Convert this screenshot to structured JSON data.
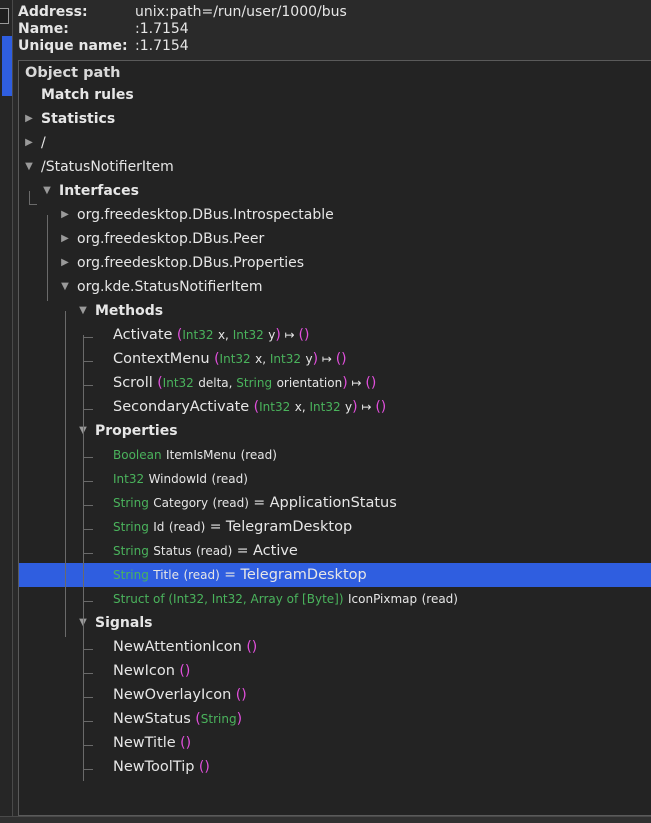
{
  "header": {
    "address_label": "Address:",
    "address_value": "unix:path=/run/user/1000/bus",
    "name_label": "Name:",
    "name_value": ":1.7154",
    "unique_label": "Unique name:",
    "unique_value": ":1.7154"
  },
  "tree": {
    "column_header": "Object path",
    "match_rules": "Match rules",
    "statistics": "Statistics",
    "root": "/",
    "status_notifier_path": "/StatusNotifierItem",
    "interfaces": "Interfaces",
    "iface_introspectable": "org.freedesktop.DBus.Introspectable",
    "iface_peer": "org.freedesktop.DBus.Peer",
    "iface_properties": "org.freedesktop.DBus.Properties",
    "iface_sni": "org.kde.StatusNotifierItem",
    "methods": "Methods",
    "properties": "Properties",
    "signals": "Signals"
  },
  "methods": [
    {
      "name": "Activate",
      "args": [
        {
          "type": "Int32",
          "name": "x"
        },
        {
          "type": "Int32",
          "name": "y"
        }
      ]
    },
    {
      "name": "ContextMenu",
      "args": [
        {
          "type": "Int32",
          "name": "x"
        },
        {
          "type": "Int32",
          "name": "y"
        }
      ]
    },
    {
      "name": "Scroll",
      "args": [
        {
          "type": "Int32",
          "name": "delta"
        },
        {
          "type": "String",
          "name": "orientation"
        }
      ]
    },
    {
      "name": "SecondaryActivate",
      "args": [
        {
          "type": "Int32",
          "name": "x"
        },
        {
          "type": "Int32",
          "name": "y"
        }
      ]
    }
  ],
  "method_punct": {
    "open": "(",
    "sep": ", ",
    "close": ")",
    "arrow": " ↦ ",
    "result": "()"
  },
  "properties": [
    {
      "type": "Boolean",
      "name": "ItemIsMenu",
      "access": "(read)",
      "value": ""
    },
    {
      "type": "Int32",
      "name": "WindowId",
      "access": "(read)",
      "value": ""
    },
    {
      "type": "String",
      "name": "Category",
      "access": "(read)",
      "value": "ApplicationStatus"
    },
    {
      "type": "String",
      "name": "Id",
      "access": "(read)",
      "value": "TelegramDesktop"
    },
    {
      "type": "String",
      "name": "Status",
      "access": "(read)",
      "value": "Active"
    },
    {
      "type": "String",
      "name": "Title",
      "access": "(read)",
      "value": "TelegramDesktop",
      "selected": true
    },
    {
      "type": "Struct of (Int32, Int32, Array of [Byte])",
      "name": "IconPixmap",
      "access": "(read)",
      "value": ""
    }
  ],
  "property_eq": " = ",
  "signals": [
    {
      "name": "NewAttentionIcon",
      "sig_open": "(",
      "sig_type": "",
      "sig_close": ")"
    },
    {
      "name": "NewIcon",
      "sig_open": "(",
      "sig_type": "",
      "sig_close": ")"
    },
    {
      "name": "NewOverlayIcon",
      "sig_open": "(",
      "sig_type": "",
      "sig_close": ")"
    },
    {
      "name": "NewStatus",
      "sig_open": "(",
      "sig_type": "String",
      "sig_close": ")"
    },
    {
      "name": "NewTitle",
      "sig_open": "(",
      "sig_type": "",
      "sig_close": ")"
    },
    {
      "name": "NewToolTip",
      "sig_open": "(",
      "sig_type": "",
      "sig_close": ")"
    }
  ],
  "colors": {
    "selection": "#2f5ee0",
    "signature": "#e14fdc",
    "type": "#4ab35c"
  }
}
